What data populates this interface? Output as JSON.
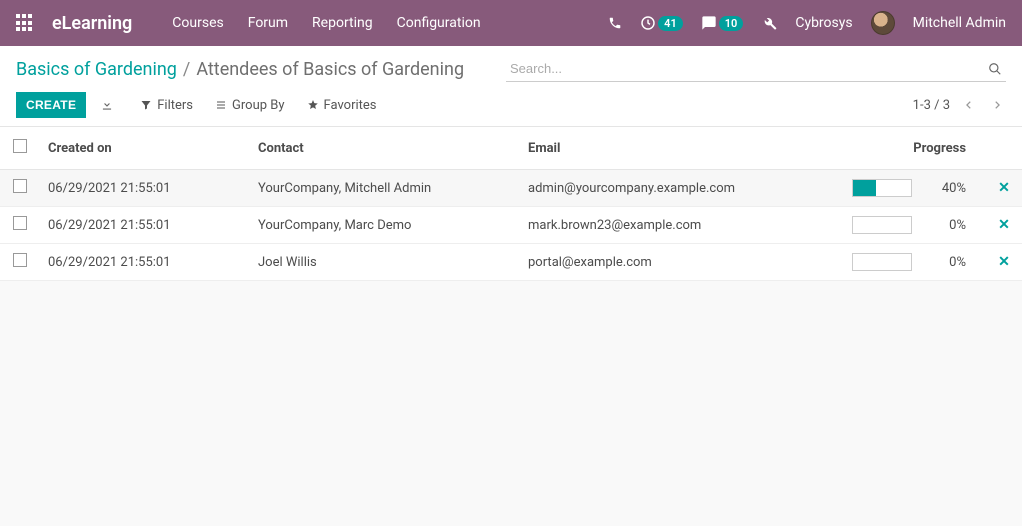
{
  "brand": "eLearning",
  "menu": [
    "Courses",
    "Forum",
    "Reporting",
    "Configuration"
  ],
  "notif_timer": "41",
  "notif_chat": "10",
  "company": "Cybrosys",
  "user": "Mitchell Admin",
  "breadcrumb": {
    "link": "Basics of Gardening",
    "sep": "/",
    "current": "Attendees of Basics of Gardening"
  },
  "search_placeholder": "Search...",
  "buttons": {
    "create": "CREATE",
    "filters": "Filters",
    "groupby": "Group By",
    "favorites": "Favorites"
  },
  "pager": "1-3 / 3",
  "columns": {
    "created": "Created on",
    "contact": "Contact",
    "email": "Email",
    "progress": "Progress"
  },
  "rows": [
    {
      "created": "06/29/2021 21:55:01",
      "contact": "YourCompany, Mitchell Admin",
      "email": "admin@yourcompany.example.com",
      "progress": 40,
      "progress_label": "40%"
    },
    {
      "created": "06/29/2021 21:55:01",
      "contact": "YourCompany, Marc Demo",
      "email": "mark.brown23@example.com",
      "progress": 0,
      "progress_label": "0%"
    },
    {
      "created": "06/29/2021 21:55:01",
      "contact": "Joel Willis",
      "email": "portal@example.com",
      "progress": 0,
      "progress_label": "0%"
    }
  ]
}
